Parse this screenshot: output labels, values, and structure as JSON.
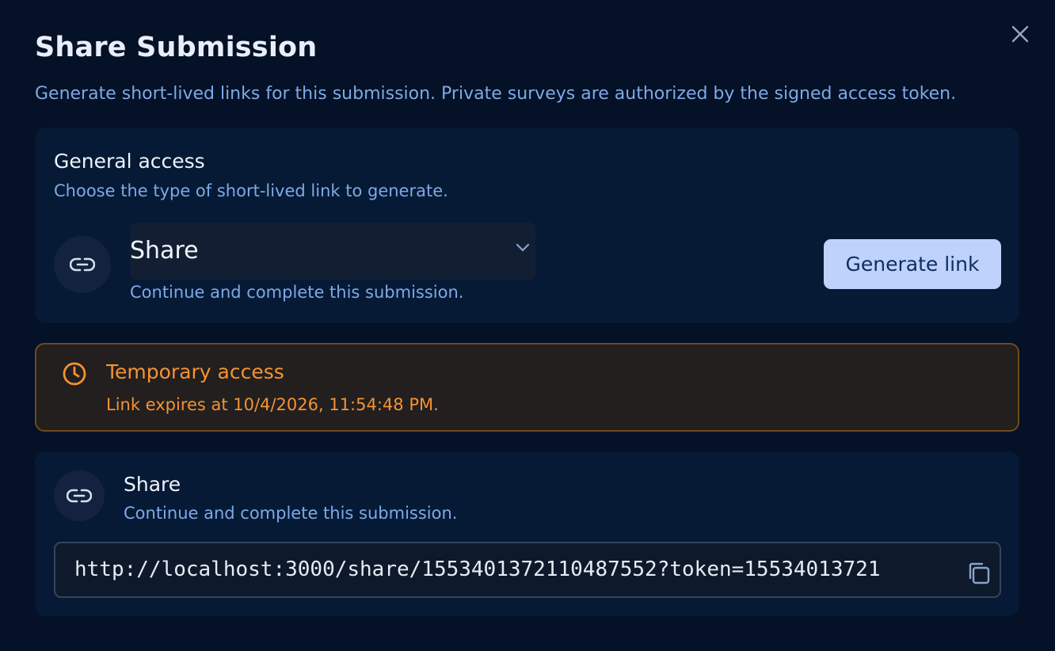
{
  "dialog": {
    "title": "Share Submission",
    "subtitle": "Generate short-lived links for this submission. Private surveys are authorized by the signed access token.",
    "close_icon": "close-icon"
  },
  "general_access": {
    "heading": "General access",
    "subheading": "Choose the type of short-lived link to generate.",
    "icon": "link-icon",
    "link_type": {
      "selected": "Share",
      "description": "Continue and complete this submission."
    },
    "generate_button": "Generate link"
  },
  "notice": {
    "icon": "clock-icon",
    "title": "Temporary access",
    "detail": "Link expires at 10/4/2026, 11:54:48 PM.",
    "color": "#f59233"
  },
  "generated_link": {
    "icon": "link-icon",
    "title": "Share",
    "description": "Continue and complete this submission.",
    "url": "http://localhost:3000/share/1553401372110487552?token=15534013721",
    "copy_icon": "copy-icon"
  },
  "colors": {
    "background": "#041126",
    "card": "#061a36",
    "accent_text": "#7ea9e6",
    "button": "#bfd2fb",
    "warning": "#f59233"
  }
}
